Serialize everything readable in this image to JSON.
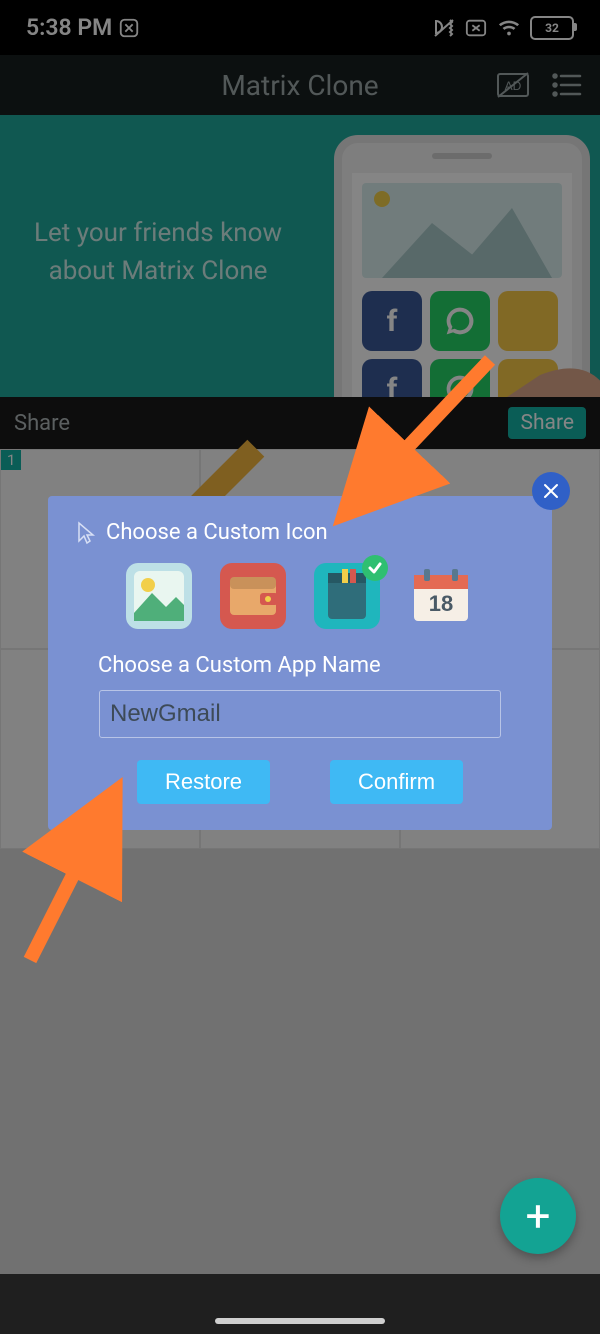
{
  "status": {
    "time": "5:38 PM",
    "battery": "32"
  },
  "header": {
    "title": "Matrix Clone"
  },
  "banner": {
    "line1": "Let your friends know",
    "line2": "about Matrix Clone"
  },
  "sharebar": {
    "label": "Share",
    "button": "Share"
  },
  "grid": {
    "badge": "1"
  },
  "dialog": {
    "title": "Choose a Custom Icon",
    "subtitle": "Choose a Custom App Name",
    "input_value": "NewGmail",
    "restore": "Restore",
    "confirm": "Confirm",
    "icons": {
      "gallery": "gallery-icon",
      "wallet": "wallet-icon",
      "notebook": "notebook-icon",
      "calendar": "calendar-icon",
      "cal_day": "18"
    },
    "selected_index": 2
  },
  "fab": {
    "glyph": "+"
  }
}
